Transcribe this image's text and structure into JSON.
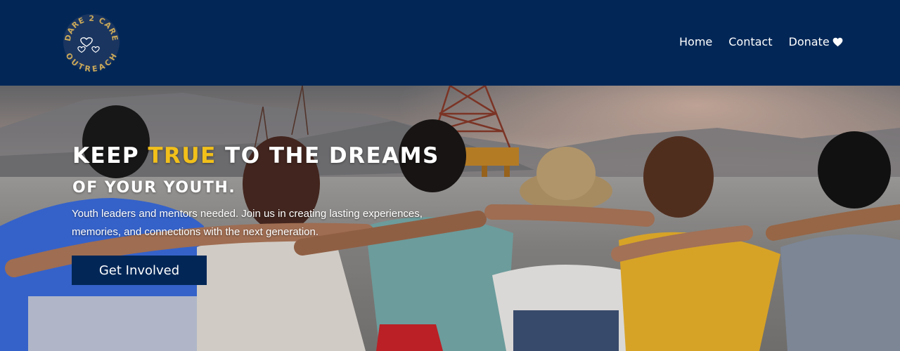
{
  "brand": {
    "logo_text_top": "DARE 2 CARE",
    "logo_text_bottom": "OUTREACH",
    "logo_color": "#c9a85a"
  },
  "nav": {
    "items": [
      {
        "label": "Home"
      },
      {
        "label": "Contact"
      },
      {
        "label": "Donate",
        "icon": "heart-icon"
      }
    ]
  },
  "hero": {
    "headline_part1": "KEEP ",
    "headline_accent": "TRUE",
    "headline_part2": " TO THE DREAMS",
    "headline_line2": "OF YOUR YOUTH.",
    "subtext": "Youth leaders and mentors needed. Join us in creating lasting experiences, memories, and connections with the next generation.",
    "cta_label": "Get Involved"
  },
  "colors": {
    "primary": "#022757",
    "accent": "#f2c01a",
    "text": "#ffffff"
  }
}
